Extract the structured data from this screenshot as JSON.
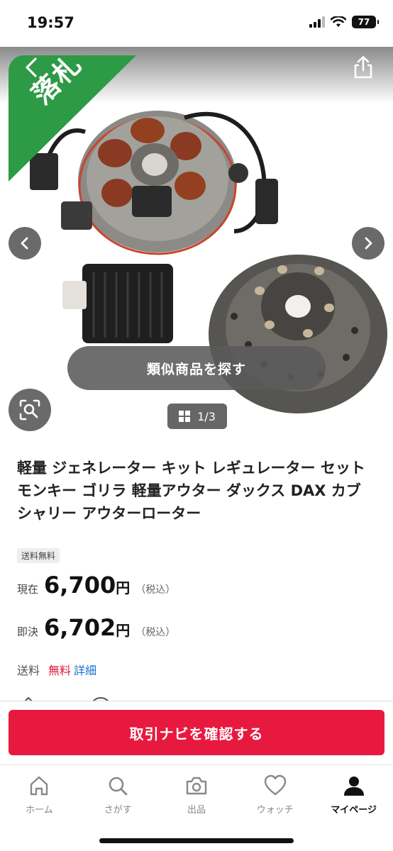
{
  "status": {
    "time": "19:57",
    "battery": "77"
  },
  "gallery": {
    "won_label": "落札",
    "similar_button": "類似商品を探す",
    "page_counter": "1/3"
  },
  "item": {
    "title": "軽量 ジェネレーター キット レギュレーター セット モンキー ゴリラ 軽量アウター ダックス DAX カブ シャリー アウターローター",
    "shipping_badge": "送料無料",
    "current_label": "現在",
    "current_price": "6,700",
    "buyout_label": "即決",
    "buyout_price": "6,702",
    "yen": "円",
    "tax_note": "（税込）",
    "shipping_label": "送料",
    "shipping_value": "無料",
    "shipping_detail": "詳細"
  },
  "cta": {
    "label": "取引ナビを確認する"
  },
  "tabs": [
    {
      "label": "ホーム",
      "icon": "home-icon"
    },
    {
      "label": "さがす",
      "icon": "search-icon"
    },
    {
      "label": "出品",
      "icon": "camera-icon"
    },
    {
      "label": "ウォッチ",
      "icon": "heart-icon"
    },
    {
      "label": "マイページ",
      "icon": "person-icon"
    }
  ],
  "colors": {
    "accent_red": "#e8193f",
    "won_green": "#2d9a46",
    "link_blue": "#1a6fd0"
  }
}
